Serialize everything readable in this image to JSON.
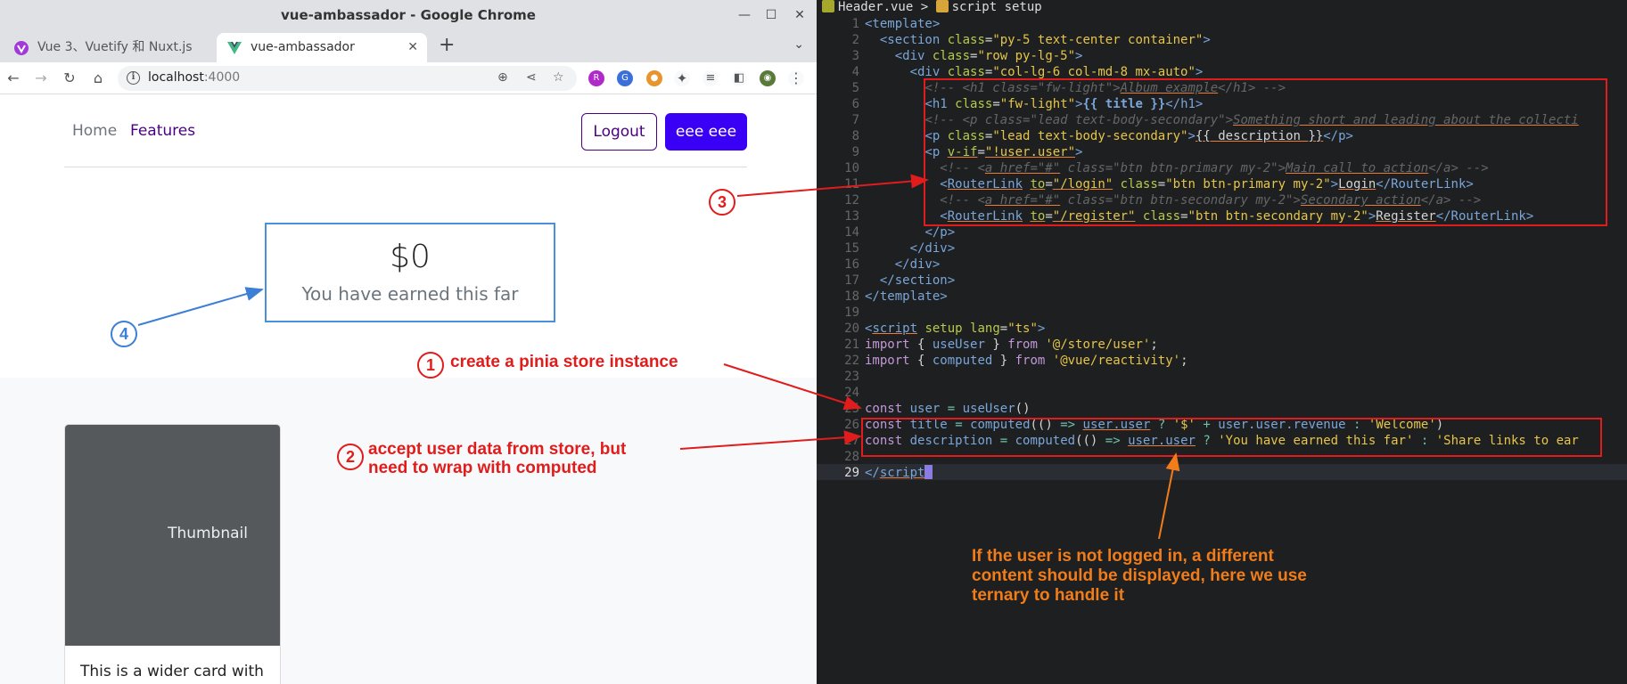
{
  "window": {
    "title": "vue-ambassador - Google Chrome"
  },
  "tabs": [
    {
      "label": "Vue 3、Vuetify 和 Nuxt.js",
      "active": false
    },
    {
      "label": "vue-ambassador",
      "active": true
    }
  ],
  "toolbar": {
    "url_host": "localhost",
    "url_port": ":4000"
  },
  "page": {
    "nav": {
      "home": "Home",
      "features": "Features",
      "logout": "Logout",
      "user": "eee eee"
    },
    "hero": {
      "title": "$0",
      "description": "You have earned this far"
    },
    "card": {
      "thumbnail": "Thumbnail",
      "text": "This is a wider card with"
    }
  },
  "editor": {
    "breadcrumb": "Header.vue > ",
    "breadcrumb_tail": "script setup",
    "current_line": 29,
    "line_numbers": [
      "1",
      "2",
      "3",
      "4",
      "5",
      "6",
      "7",
      "8",
      "9",
      "10",
      "11",
      "12",
      "13",
      "14",
      "15",
      "16",
      "17",
      "18",
      "19",
      "20",
      "21",
      "22",
      "23",
      "24",
      "25",
      "26",
      "27",
      "28",
      "29"
    ]
  },
  "annotations": {
    "n1": "1",
    "n2": "2",
    "n3": "3",
    "n4": "4",
    "note1": "create a pinia store instance",
    "note2_line1": "accept user data from store, but",
    "note2_line2": "need to wrap with computed",
    "note3_line1": "If the user is not logged in, a different",
    "note3_line2": "content should be displayed, here we use",
    "note3_line3": "ternary to handle it"
  },
  "colors": {
    "annotation_red": "#e01c1c",
    "annotation_blue": "#3d7fd6",
    "annotation_orange": "#f07c1a",
    "primary_button": "#3a00f5"
  }
}
